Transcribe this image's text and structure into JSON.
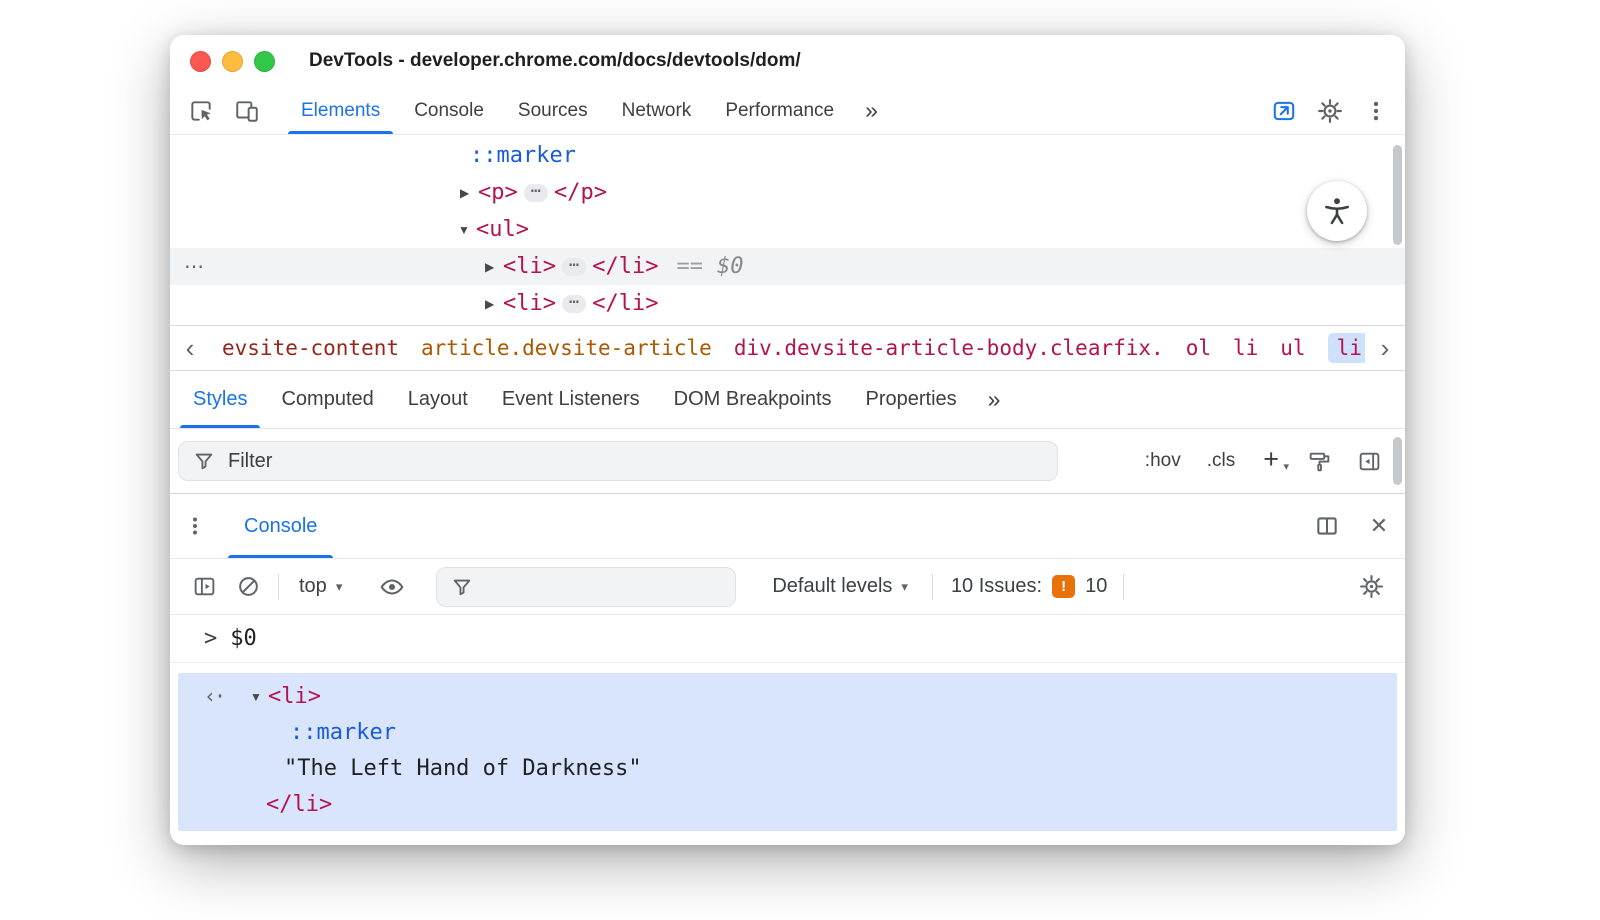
{
  "colors": {
    "accent_blue": "#1a73e8",
    "code_tag": "#b3134f",
    "code_pseudo": "#1a5cd8",
    "breadcrumb_dark_red": "#96261b",
    "breadcrumb_orange": "#ad5700",
    "icon_gray": "#5f6368",
    "muted_gray": "#9aa0a6",
    "issues_orange": "#e8710a",
    "selection_blue_bg": "#d8e5fc",
    "crumb_selected_bg": "#cfe0fb",
    "selected_row_bg": "#f1f3f4"
  },
  "window": {
    "title": "DevTools - developer.chrome.com/docs/devtools/dom/"
  },
  "icons": {
    "ellipsis": "⋯",
    "overflow": "⋯",
    "collapsed": "▶",
    "expanded": "▼",
    "more_tabs": "»",
    "chevron_left": "‹",
    "chevron_right": "›",
    "close": "✕",
    "caret_down": "▾",
    "prompt": ">",
    "result_marker": "‹·",
    "issues_exclamation": "!"
  },
  "main_toolbar": {
    "tabs": [
      {
        "label": "Elements",
        "active": true
      },
      {
        "label": "Console",
        "active": false
      },
      {
        "label": "Sources",
        "active": false
      },
      {
        "label": "Network",
        "active": false
      },
      {
        "label": "Performance",
        "active": false
      }
    ]
  },
  "elements_panel": {
    "pseudo_marker": "::marker",
    "p_open": "<p>",
    "p_close": "</p>",
    "ul_open": "<ul>",
    "li_open": "<li>",
    "li_close": "</li>",
    "equals": "==",
    "dollar_zero": "$0"
  },
  "breadcrumbs": {
    "items": [
      {
        "label": "evsite-content",
        "selected": false
      },
      {
        "label": "article.devsite-article",
        "selected": false
      },
      {
        "label": "div.devsite-article-body.clearfix.",
        "selected": false
      },
      {
        "label": "ol",
        "selected": false
      },
      {
        "label": "li",
        "selected": false
      },
      {
        "label": "ul",
        "selected": false
      },
      {
        "label": "li",
        "selected": true
      }
    ]
  },
  "styles_panel": {
    "tabs": [
      {
        "label": "Styles",
        "active": true
      },
      {
        "label": "Computed",
        "active": false
      },
      {
        "label": "Layout",
        "active": false
      },
      {
        "label": "Event Listeners",
        "active": false
      },
      {
        "label": "DOM Breakpoints",
        "active": false
      },
      {
        "label": "Properties",
        "active": false
      }
    ],
    "filter_placeholder": "Filter",
    "hov_label": ":hov",
    "cls_label": ".cls",
    "plus_label": "+"
  },
  "drawer": {
    "tab_label": "Console"
  },
  "console_toolbar": {
    "context_label": "top",
    "levels_label": "Default levels",
    "issues_label": "10 Issues:",
    "issues_count": "10"
  },
  "console": {
    "command": "$0",
    "result": {
      "li_open": "<li>",
      "pseudo_marker": "::marker",
      "string": "\"The Left Hand of Darkness\"",
      "li_close": "</li>"
    }
  }
}
